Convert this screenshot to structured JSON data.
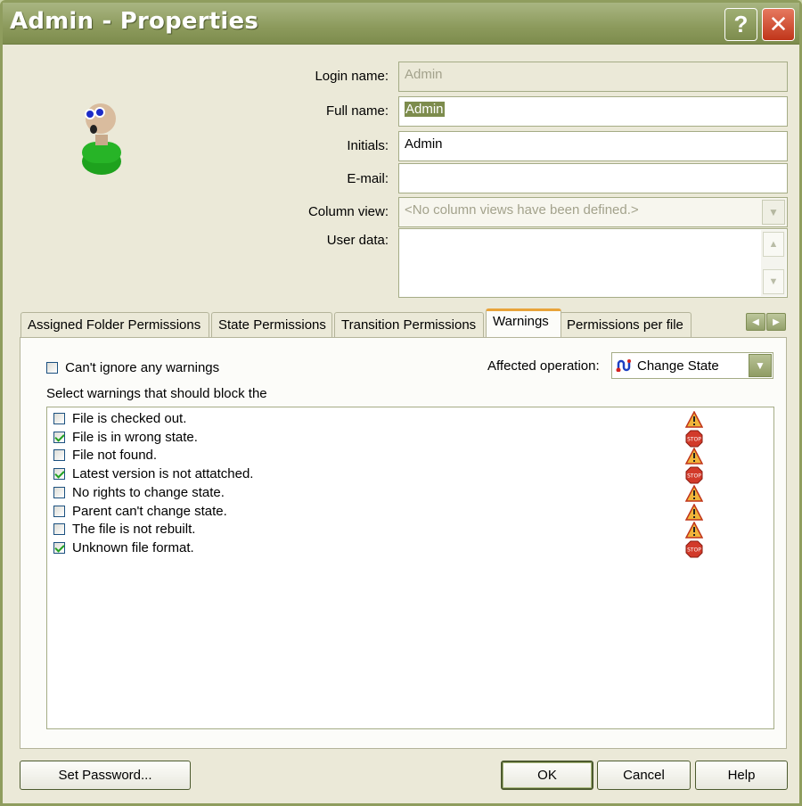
{
  "window": {
    "title": "Admin - Properties",
    "help_glyph": "?",
    "close_glyph": "✕"
  },
  "fields": {
    "login_name_label": "Login name:",
    "login_name_value": "Admin",
    "full_name_label": "Full name:",
    "full_name_value": "Admin",
    "initials_label": "Initials:",
    "initials_value": "Admin",
    "email_label": "E-mail:",
    "email_value": "",
    "column_view_label": "Column view:",
    "column_view_value": "<No column views have been defined.>",
    "user_data_label": "User data:",
    "user_data_value": ""
  },
  "tabs": [
    {
      "label": "Assigned Folder Permissions",
      "active": false
    },
    {
      "label": "State Permissions",
      "active": false
    },
    {
      "label": "Transition Permissions",
      "active": false
    },
    {
      "label": "Warnings",
      "active": true
    },
    {
      "label": "Permissions per file",
      "active": false
    }
  ],
  "warnings_panel": {
    "cant_ignore_label": "Can't ignore any warnings",
    "cant_ignore_checked": false,
    "affected_operation_label": "Affected operation:",
    "affected_operation_value": "Change State",
    "select_warnings_label": "Select warnings that should block the",
    "items": [
      {
        "label": "File is checked out.",
        "checked": false,
        "icon": "warning-triangle-icon"
      },
      {
        "label": "File is in wrong state.",
        "checked": true,
        "icon": "stop-sign-icon"
      },
      {
        "label": "File not found.",
        "checked": false,
        "icon": "warning-triangle-icon"
      },
      {
        "label": "Latest version is not attatched.",
        "checked": true,
        "icon": "stop-sign-icon"
      },
      {
        "label": "No rights to change state.",
        "checked": false,
        "icon": "warning-triangle-icon"
      },
      {
        "label": "Parent can't change state.",
        "checked": false,
        "icon": "warning-triangle-icon"
      },
      {
        "label": "The file is not rebuilt.",
        "checked": false,
        "icon": "warning-triangle-icon"
      },
      {
        "label": "Unknown file format.",
        "checked": true,
        "icon": "stop-sign-icon"
      }
    ],
    "stop_icon_text": "STOP"
  },
  "buttons": {
    "set_password": "Set Password...",
    "ok": "OK",
    "cancel": "Cancel",
    "help": "Help"
  }
}
